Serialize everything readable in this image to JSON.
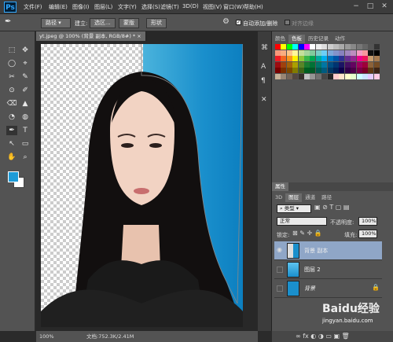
{
  "app_logo": "Ps",
  "menu": [
    "文件(F)",
    "编辑(E)",
    "图像(I)",
    "图层(L)",
    "文字(Y)",
    "选择(S)",
    "滤镜(T)",
    "3D(D)",
    "视图(V)",
    "窗口(W)",
    "帮助(H)"
  ],
  "window_controls": {
    "minimize": "−",
    "maximize": "□",
    "close": "✕"
  },
  "options": {
    "mode": "路径",
    "create_label": "建立:",
    "selection": "选区...",
    "mask": "蒙版",
    "shape": "形状",
    "auto_add_delete": "自动添加/删除",
    "align_edges": "对齐边缘"
  },
  "document": {
    "tab_title": "yt.jpeg @ 100% (背景 副本, RGB/8#) *",
    "close": "×",
    "zoom": "100%",
    "doc_size": "文档:752.3K/2.41M"
  },
  "colors": {
    "foreground": "#1e9bd7",
    "background": "#ffffff",
    "accent": "#31a8ff"
  },
  "panels": {
    "swatches_tabs": [
      "颜色",
      "色板",
      "历史记录",
      "动作"
    ],
    "properties_tab": "属性",
    "layers_tabs": [
      "3D",
      "图层",
      "通道",
      "路径"
    ],
    "filter_kind": "类型",
    "blend_mode": "正常",
    "opacity_label": "不透明度:",
    "opacity": "100%",
    "lock_label": "锁定:",
    "fill_label": "填充:",
    "fill": "100%",
    "layers": [
      {
        "name": "背景 副本",
        "visible": true
      },
      {
        "name": "图层 2",
        "visible": false
      },
      {
        "name": "背景",
        "visible": true
      }
    ]
  },
  "watermark": {
    "brand": "Baidu经验",
    "url": "jingyan.baidu.com"
  }
}
